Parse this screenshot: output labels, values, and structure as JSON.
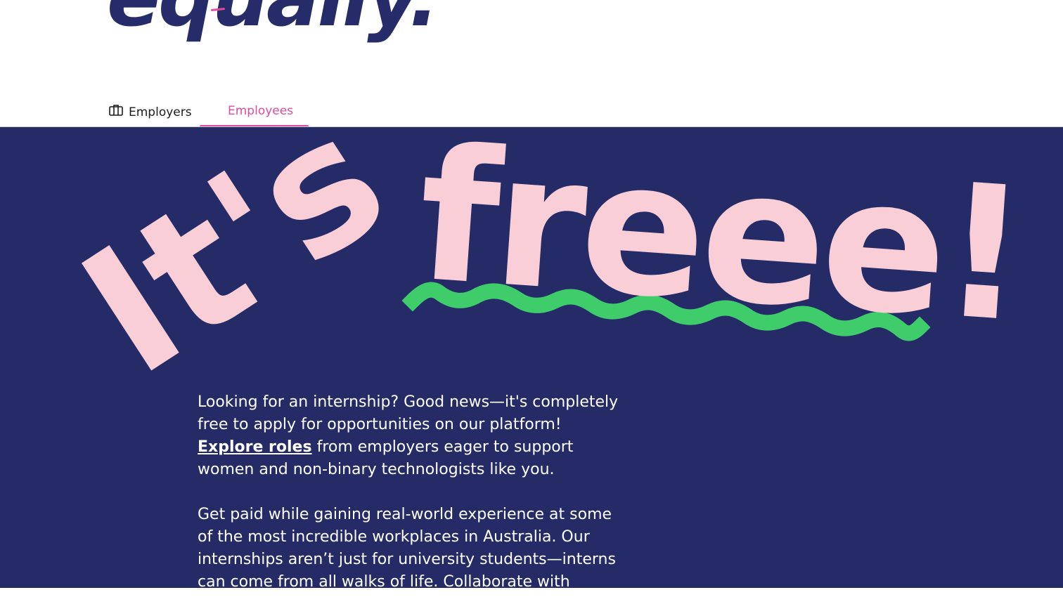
{
  "brand": {
    "logo_text": "equally."
  },
  "tabs": [
    {
      "label": "Employers",
      "icon": "briefcase-icon",
      "active": false
    },
    {
      "label": "Employees",
      "active": true
    }
  ],
  "hero": {
    "headline_part1": "It's",
    "headline_part2": "freee!",
    "paragraph1": {
      "intro": "Looking for an internship? Good news—it's completely free to apply for opportunities on our platform!",
      "link_text": "Explore roles",
      "after_link": "from employers eager to support women and non-binary technologists like you."
    },
    "paragraph2": "Get paid while gaining real-world experience at some of the most incredible workplaces in Australia. Our internships aren’t just for university students—interns can come from all walks of life. Collaborate with"
  },
  "colors": {
    "navy": "#242b67",
    "pink_accent": "#e24b9d",
    "headline_pink": "#f9ced6",
    "squiggle_green": "#3fcd6b"
  }
}
